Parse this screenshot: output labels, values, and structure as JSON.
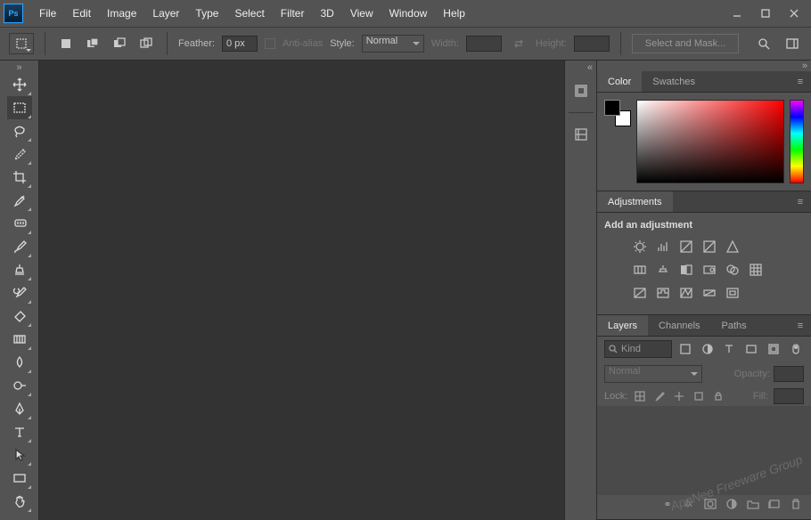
{
  "app": {
    "logo": "Ps"
  },
  "menu": [
    "File",
    "Edit",
    "Image",
    "Layer",
    "Type",
    "Select",
    "Filter",
    "3D",
    "View",
    "Window",
    "Help"
  ],
  "options_bar": {
    "feather_label": "Feather:",
    "feather_value": "0 px",
    "antialias_label": "Anti-alias",
    "style_label": "Style:",
    "style_value": "Normal",
    "width_label": "Width:",
    "height_label": "Height:",
    "select_mask_label": "Select and Mask..."
  },
  "panels": {
    "color_tab": "Color",
    "swatches_tab": "Swatches",
    "adjustments_tab": "Adjustments",
    "adjustments_header": "Add an adjustment",
    "layers_tab": "Layers",
    "channels_tab": "Channels",
    "paths_tab": "Paths",
    "layer_kind_label": "Kind",
    "blend_mode": "Normal",
    "opacity_label": "Opacity:",
    "lock_label": "Lock:",
    "fill_label": "Fill:"
  },
  "watermark": "AppNee Freeware Group"
}
